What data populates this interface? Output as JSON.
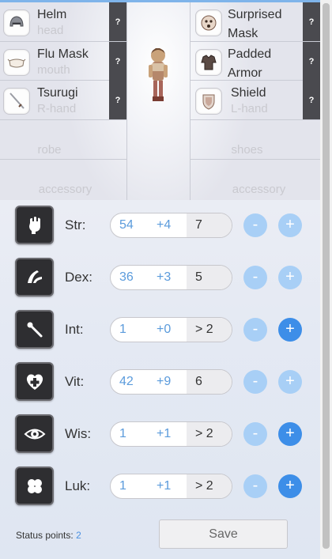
{
  "equipment": {
    "left": [
      {
        "name": "Helm",
        "position": "head",
        "icon": "helm-icon"
      },
      {
        "name": "Flu Mask",
        "position": "mouth",
        "icon": "flu-mask-icon"
      },
      {
        "name": "Tsurugi",
        "position": "R-hand",
        "icon": "sword-icon"
      },
      {
        "name": "",
        "position": "robe"
      },
      {
        "name": "",
        "position": "accessory"
      }
    ],
    "right": [
      {
        "name": "Surprised Mask",
        "name_line1": "Surprised",
        "name_line2": "Mask",
        "position": "",
        "icon": "surprised-mask-icon"
      },
      {
        "name": "Padded Armor",
        "name_line1": "Padded",
        "name_line2": "Armor",
        "position": "",
        "icon": "armor-icon"
      },
      {
        "name": "Shield",
        "position": "L-hand",
        "icon": "shield-icon"
      },
      {
        "name": "",
        "position": "shoes"
      },
      {
        "name": "",
        "position": "accessory"
      }
    ],
    "help_label": "?"
  },
  "stats": [
    {
      "label": "Str:",
      "base": "54",
      "bonus": "+4",
      "cost": "7",
      "icon": "fist-icon",
      "plus_active": false
    },
    {
      "label": "Dex:",
      "base": "36",
      "bonus": "+3",
      "cost": "5",
      "icon": "bow-icon",
      "plus_active": false
    },
    {
      "label": "Int:",
      "base": "1",
      "bonus": "+0",
      "cost": "> 2",
      "icon": "staff-icon",
      "plus_active": true
    },
    {
      "label": "Vit:",
      "base": "42",
      "bonus": "+9",
      "cost": "6",
      "icon": "heart-plus-icon",
      "plus_active": false
    },
    {
      "label": "Wis:",
      "base": "1",
      "bonus": "+1",
      "cost": "> 2",
      "icon": "eye-icon",
      "plus_active": true
    },
    {
      "label": "Luk:",
      "base": "1",
      "bonus": "+1",
      "cost": "> 2",
      "icon": "clover-icon",
      "plus_active": true
    }
  ],
  "buttons": {
    "minus": "-",
    "plus": "+"
  },
  "footer": {
    "status_points_label": "Status points:",
    "status_points_value": "2",
    "save_label": "Save"
  },
  "colors": {
    "accent": "#3d8ee8",
    "accent_light": "#a8cff6",
    "help_bg": "#4a4a4f"
  }
}
